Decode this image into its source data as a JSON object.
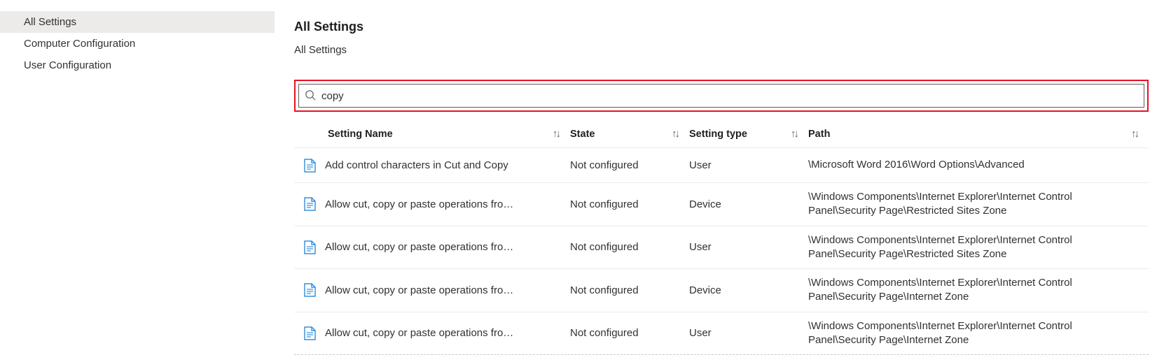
{
  "sidebar": {
    "items": [
      {
        "label": "All Settings",
        "selected": true
      },
      {
        "label": "Computer Configuration",
        "selected": false
      },
      {
        "label": "User Configuration",
        "selected": false
      }
    ]
  },
  "header": {
    "title": "All Settings",
    "breadcrumb": "All Settings"
  },
  "search": {
    "value": "copy"
  },
  "table": {
    "columns": [
      {
        "label": "Setting Name"
      },
      {
        "label": "State"
      },
      {
        "label": "Setting type"
      },
      {
        "label": "Path"
      }
    ],
    "rows": [
      {
        "name": "Add control characters in Cut and Copy",
        "state": "Not configured",
        "type": "User",
        "path": "\\Microsoft Word 2016\\Word Options\\Advanced"
      },
      {
        "name": "Allow cut, copy or paste operations fro…",
        "state": "Not configured",
        "type": "Device",
        "path": "\\Windows Components\\Internet Explorer\\Internet Control Panel\\Security Page\\Restricted Sites Zone"
      },
      {
        "name": "Allow cut, copy or paste operations fro…",
        "state": "Not configured",
        "type": "User",
        "path": "\\Windows Components\\Internet Explorer\\Internet Control Panel\\Security Page\\Restricted Sites Zone"
      },
      {
        "name": "Allow cut, copy or paste operations fro…",
        "state": "Not configured",
        "type": "Device",
        "path": "\\Windows Components\\Internet Explorer\\Internet Control Panel\\Security Page\\Internet Zone"
      },
      {
        "name": "Allow cut, copy or paste operations fro…",
        "state": "Not configured",
        "type": "User",
        "path": "\\Windows Components\\Internet Explorer\\Internet Control Panel\\Security Page\\Internet Zone"
      }
    ]
  },
  "icons": {
    "search": "search-icon",
    "sort": "sort-updown-icon",
    "doc": "document-icon"
  }
}
